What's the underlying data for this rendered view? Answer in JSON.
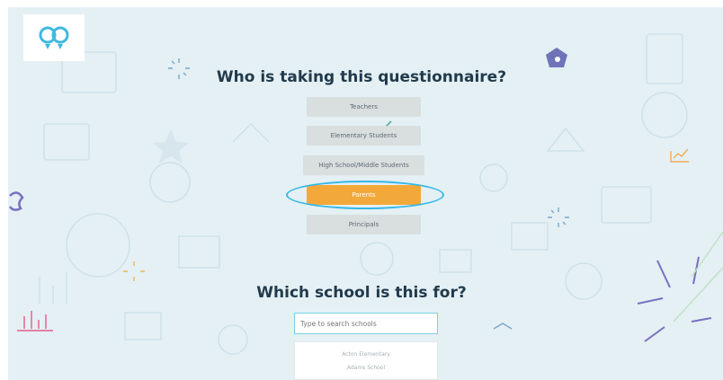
{
  "questionnaire": {
    "question": "Who is taking this questionnaire?",
    "options": [
      {
        "label": "Teachers",
        "selected": false
      },
      {
        "label": "Elementary Students",
        "selected": false
      },
      {
        "label": "High School/Middle Students",
        "selected": false
      },
      {
        "label": "Parents",
        "selected": true
      },
      {
        "label": "Principals",
        "selected": false
      }
    ]
  },
  "school": {
    "question": "Which school is this for?",
    "search_placeholder": "Type to search schools",
    "results": [
      "Acton Elementary",
      "Adams School"
    ]
  },
  "colors": {
    "background": "#e4f0f4",
    "heading": "#213a4c",
    "option": "#d9dedf",
    "selected": "#f3a93a",
    "highlight_ring": "#35b8e8"
  },
  "icons": [
    "logo-icon"
  ]
}
